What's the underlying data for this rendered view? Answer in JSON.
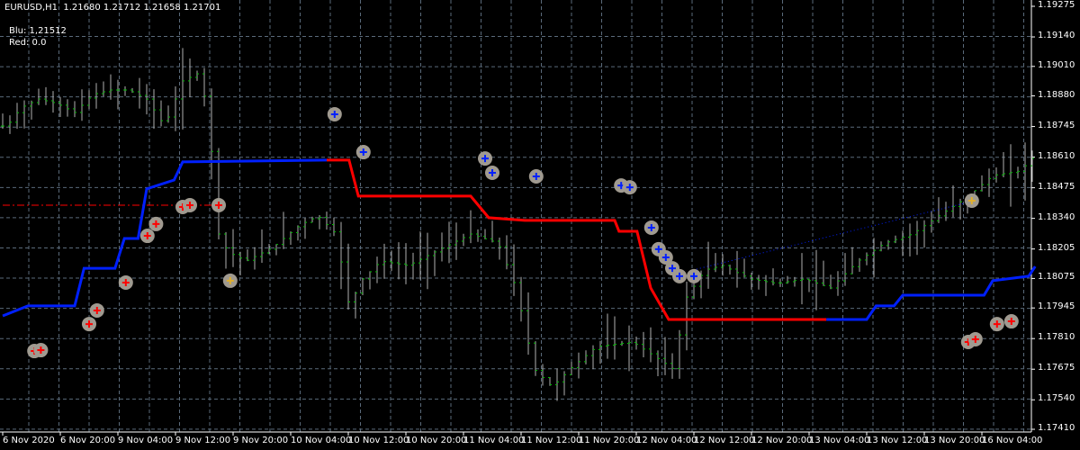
{
  "header": {
    "symbol": "EURUSD,H1",
    "ohlc": "1.21680 1.21712 1.21658 1.21701"
  },
  "indicator": {
    "blu_label": "Blu: 1,21512",
    "red_label": "Red: 0.0"
  },
  "colors": {
    "bg": "#000000",
    "grid": "#5a6a7a",
    "candle": "#00c000",
    "bar": "#b0b0b0",
    "blue": "#0020ff",
    "red": "#ff0000",
    "marker": "#a09a90"
  },
  "chart_data": {
    "type": "line",
    "title": "EURUSD,H1",
    "ylim": [
      1.1741,
      1.19275
    ],
    "y_ticks": [
      "1.19275",
      "1.19140",
      "1.19010",
      "1.18880",
      "1.18745",
      "1.18610",
      "1.18475",
      "1.18340",
      "1.18205",
      "1.18075",
      "1.17945",
      "1.17810",
      "1.17675",
      "1.17540",
      "1.17410"
    ],
    "x_ticks": [
      "6 Nov 2020",
      "6 Nov 20:00",
      "9 Nov 04:00",
      "9 Nov 12:00",
      "9 Nov 20:00",
      "10 Nov 04:00",
      "10 Nov 12:00",
      "10 Nov 20:00",
      "11 Nov 04:00",
      "11 Nov 12:00",
      "11 Nov 20:00",
      "12 Nov 04:00",
      "12 Nov 12:00",
      "12 Nov 20:00",
      "13 Nov 04:00",
      "13 Nov 12:00",
      "13 Nov 20:00",
      "16 Nov 04:00"
    ],
    "x_unit": "bar index (H1)",
    "price_path": [
      [
        0.6,
        1.18747
      ],
      [
        2.5,
        1.18827
      ],
      [
        5,
        1.18866
      ],
      [
        7.5,
        1.18847
      ],
      [
        10,
        1.18807
      ],
      [
        12.5,
        1.18886
      ],
      [
        15,
        1.18906
      ],
      [
        17.5,
        1.18906
      ],
      [
        20,
        1.18866
      ],
      [
        22.5,
        1.18747
      ],
      [
        25,
        1.18946
      ],
      [
        27.5,
        1.18985
      ],
      [
        28.8,
        1.18708
      ],
      [
        30,
        1.18271
      ],
      [
        31.3,
        1.18192
      ],
      [
        33.8,
        1.18152
      ],
      [
        37.5,
        1.18212
      ],
      [
        41.3,
        1.18311
      ],
      [
        43.8,
        1.18351
      ],
      [
        46.3,
        1.18271
      ],
      [
        48.1,
        1.17954
      ],
      [
        50,
        1.18073
      ],
      [
        52.5,
        1.18152
      ],
      [
        56.3,
        1.18132
      ],
      [
        60,
        1.18192
      ],
      [
        65,
        1.18271
      ],
      [
        68.8,
        1.18231
      ],
      [
        71.3,
        1.18033
      ],
      [
        73.8,
        1.17676
      ],
      [
        76.3,
        1.17597
      ],
      [
        78.8,
        1.17676
      ],
      [
        82.5,
        1.17775
      ],
      [
        87.5,
        1.17795
      ],
      [
        91.3,
        1.17716
      ],
      [
        93.1,
        1.17676
      ],
      [
        95,
        1.17993
      ],
      [
        97.5,
        1.18112
      ],
      [
        100,
        1.18132
      ],
      [
        103.8,
        1.18073
      ],
      [
        107.5,
        1.18053
      ],
      [
        111.3,
        1.18073
      ],
      [
        115,
        1.18033
      ],
      [
        118.8,
        1.18152
      ],
      [
        122.5,
        1.18231
      ],
      [
        126.3,
        1.18271
      ],
      [
        130,
        1.18351
      ],
      [
        133.8,
        1.1843
      ],
      [
        137.5,
        1.18529
      ],
      [
        141.3,
        1.18549
      ],
      [
        143.1,
        1.18608
      ]
    ],
    "series": [
      {
        "name": "blue-1",
        "color": "blue",
        "points": [
          [
            0,
            1.1791
          ],
          [
            3.5,
            1.17954
          ],
          [
            10,
            1.17954
          ],
          [
            11.3,
            1.1812
          ],
          [
            15.6,
            1.1812
          ],
          [
            16.9,
            1.18251
          ],
          [
            18.8,
            1.18251
          ],
          [
            20,
            1.1847
          ],
          [
            23.8,
            1.18509
          ],
          [
            25,
            1.18589
          ],
          [
            45,
            1.18597
          ]
        ]
      },
      {
        "name": "red",
        "color": "red",
        "points": [
          [
            45,
            1.18597
          ],
          [
            48.1,
            1.18597
          ],
          [
            49.4,
            1.18438
          ],
          [
            65,
            1.18438
          ],
          [
            67.5,
            1.18343
          ],
          [
            72.5,
            1.18331
          ],
          [
            85,
            1.18331
          ],
          [
            85.6,
            1.18283
          ],
          [
            88.1,
            1.18283
          ],
          [
            90,
            1.18033
          ],
          [
            92.5,
            1.17894
          ],
          [
            114.4,
            1.17894
          ]
        ]
      },
      {
        "name": "blue-2",
        "color": "blue",
        "points": [
          [
            114.4,
            1.17894
          ],
          [
            120,
            1.17894
          ],
          [
            121.3,
            1.17954
          ],
          [
            123.8,
            1.17954
          ],
          [
            125,
            1.18001
          ],
          [
            136.3,
            1.18001
          ],
          [
            137.5,
            1.18065
          ],
          [
            142.5,
            1.18085
          ],
          [
            143.4,
            1.18128
          ]
        ]
      }
    ],
    "level_line": {
      "price": 1.18398,
      "from": 0,
      "to": 31
    },
    "markers": [
      {
        "x": 4.4,
        "p": 1.17755,
        "t": "red"
      },
      {
        "x": 5.3,
        "p": 1.17759,
        "t": "red"
      },
      {
        "x": 12,
        "p": 1.17874,
        "t": "red"
      },
      {
        "x": 13.1,
        "p": 1.17934,
        "t": "red"
      },
      {
        "x": 17.1,
        "p": 1.18057,
        "t": "red"
      },
      {
        "x": 20.1,
        "p": 1.18263,
        "t": "red"
      },
      {
        "x": 21.3,
        "p": 1.18315,
        "t": "red"
      },
      {
        "x": 25,
        "p": 1.1839,
        "t": "red"
      },
      {
        "x": 26,
        "p": 1.18398,
        "t": "red"
      },
      {
        "x": 30,
        "p": 1.18398,
        "t": "red"
      },
      {
        "x": 31.6,
        "p": 1.18065,
        "t": "yellow"
      },
      {
        "x": 46.1,
        "p": 1.18799,
        "t": "blue"
      },
      {
        "x": 50.1,
        "p": 1.18632,
        "t": "blue"
      },
      {
        "x": 67,
        "p": 1.18604,
        "t": "blue"
      },
      {
        "x": 68,
        "p": 1.18541,
        "t": "blue"
      },
      {
        "x": 74.1,
        "p": 1.18525,
        "t": "blue"
      },
      {
        "x": 85.9,
        "p": 1.18485,
        "t": "blue"
      },
      {
        "x": 87.1,
        "p": 1.18477,
        "t": "blue"
      },
      {
        "x": 90.1,
        "p": 1.18299,
        "t": "blue"
      },
      {
        "x": 91.1,
        "p": 1.18204,
        "t": "blue"
      },
      {
        "x": 92.1,
        "p": 1.18168,
        "t": "blue"
      },
      {
        "x": 93,
        "p": 1.1812,
        "t": "blue"
      },
      {
        "x": 94,
        "p": 1.18085,
        "t": "blue"
      },
      {
        "x": 96,
        "p": 1.18085,
        "t": "blue"
      },
      {
        "x": 134.6,
        "p": 1.18418,
        "t": "yellow"
      },
      {
        "x": 134.1,
        "p": 1.17795,
        "t": "red"
      },
      {
        "x": 135.1,
        "p": 1.17807,
        "t": "red"
      },
      {
        "x": 138.1,
        "p": 1.17874,
        "t": "red"
      },
      {
        "x": 140.1,
        "p": 1.17886,
        "t": "red"
      }
    ]
  }
}
